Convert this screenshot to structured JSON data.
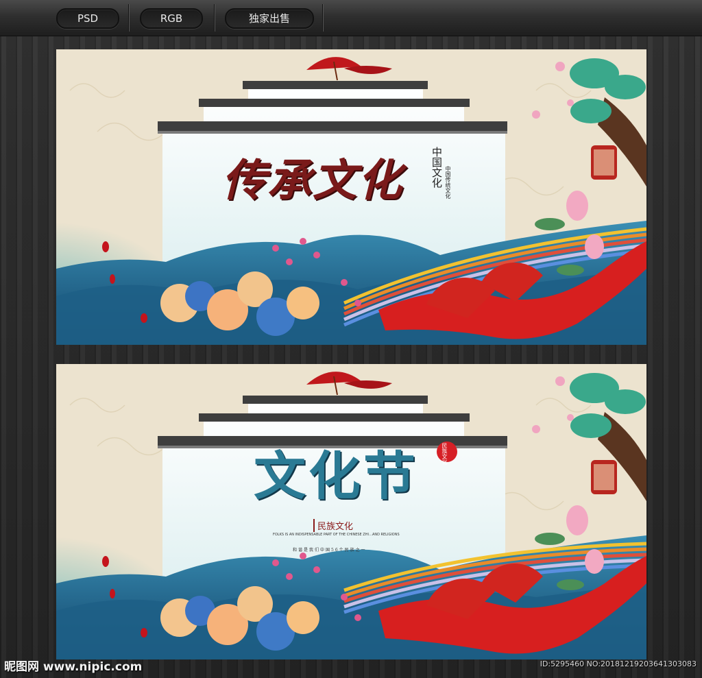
{
  "toolbar": {
    "items": [
      {
        "label": "PSD"
      },
      {
        "label": "RGB"
      },
      {
        "label": "独家出售"
      }
    ]
  },
  "poster1": {
    "title": "传承文化",
    "side_title": "中国文化",
    "side_caption": "中国传统文化"
  },
  "poster2": {
    "title": "文化节",
    "seal": "民族文化",
    "subtitle": "民族文化",
    "line1": "FOLKS IS AN INDISPENSABLE PART OF THE CHINESE ZHI…AND RELIGIONS",
    "line2": "和谐是我们中国56个民族之一"
  },
  "footer": {
    "watermark": "昵图网 www.nipic.com",
    "id": "ID:5295460 NO:20181219203641303083"
  },
  "colors": {
    "topbar": "#2f2f2f",
    "paper": "#ece3cf",
    "red": "#d71f1f",
    "ink_blue": "#1f6e92"
  }
}
